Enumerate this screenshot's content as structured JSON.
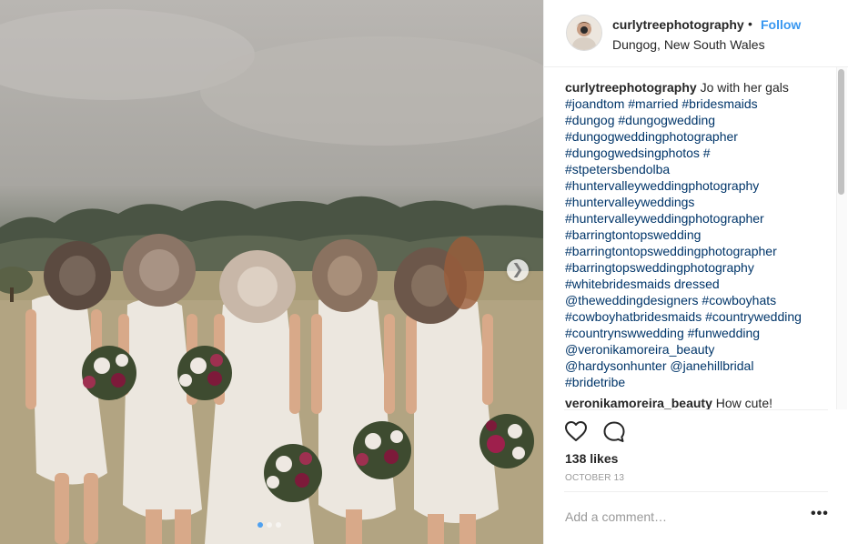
{
  "post": {
    "username": "curlytreephotography",
    "separator": "•",
    "follow_label": "Follow",
    "location": "Dungog, New South Wales",
    "caption": {
      "username": "curlytreephotography",
      "text_lines": [
        "Jo with her gals",
        "#joandtom #married #bridesmaids",
        "#dungog #dungogwedding",
        "#dungogweddingphotographer",
        "#dungogwedsingphotos #",
        "#stpetersbendolba",
        "#huntervalleyweddingphotography",
        "#huntervalleyweddings",
        "#huntervalleyweddingphotographer",
        "#barringtontopswedding",
        "#barringtontopsweddingphotographer",
        "#barringtopsweddingphotography",
        "#whitebridesmaids dressed",
        "@theweddingdesigners #cowboyhats",
        "#cowboyhatbridesmaids #countrywedding",
        "#countrynswwedding #funwedding",
        "@veronikamoreira_beauty",
        "@hardysonhunter @janehillbridal",
        "#bridetribe"
      ]
    },
    "comments": [
      {
        "username": "veronikamoreira_beauty",
        "text": "How cute!"
      }
    ],
    "likes": "138 likes",
    "date": "OCTOBER 13",
    "add_comment_placeholder": "Add a comment…",
    "more_label": "•••",
    "carousel": {
      "slide_count": 3,
      "active_index": 0
    }
  },
  "colors": {
    "link_blue": "#3897f0",
    "hashtag": "#003569",
    "muted": "#999999",
    "text": "#262626"
  },
  "icons": {
    "like": "heart-outline-icon",
    "comment": "speech-bubble-icon",
    "next": "chevron-right-icon",
    "more": "ellipsis-icon"
  }
}
